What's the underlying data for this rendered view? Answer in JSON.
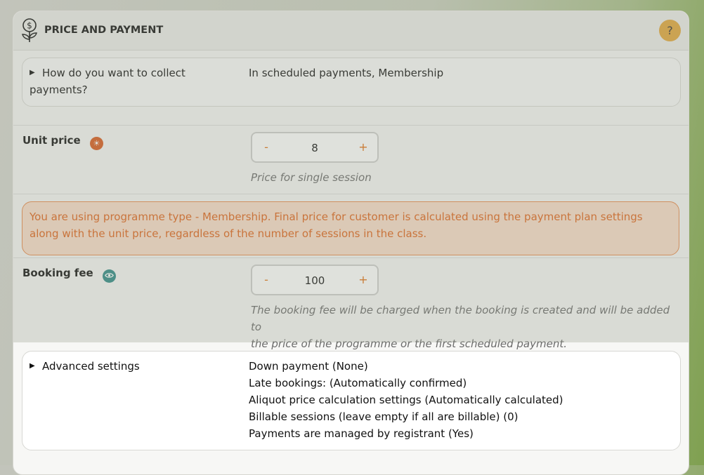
{
  "section": {
    "title": "PRICE AND PAYMENT",
    "icon": "money-plant-icon",
    "help_label": "?"
  },
  "collect": {
    "question_line1": "How do you want to collect",
    "question_line2": "payments?",
    "answer": "In scheduled payments, Membership"
  },
  "unit_price": {
    "label": "Unit price",
    "badge_icon": "sun-icon",
    "badge_color": "#d9591c",
    "minus": "-",
    "plus": "+",
    "value": "8",
    "hint": "Price for single session"
  },
  "alert": {
    "text": "You are using programme type - Membership. Final price for customer is calculated using the payment plan settings along with the unit price, regardless of the number of sessions in the class."
  },
  "booking_fee": {
    "label": "Booking fee",
    "badge_icon": "eye-icon",
    "badge_color": "#2f8a86",
    "minus": "-",
    "plus": "+",
    "value": "100",
    "hint_line1": "The booking fee will be charged when the booking is created and will be added to",
    "hint_line2": "the price of the programme or the first scheduled payment."
  },
  "advanced": {
    "label": "Advanced settings",
    "items": [
      "Down payment (None)",
      "Late bookings: (Automatically confirmed)",
      "Aliquot price calculation settings (Automatically calculated)",
      "Billable sessions (leave empty if all are billable) (0)",
      "Payments are managed by registrant (Yes)"
    ]
  },
  "colors": {
    "accent": "#e07014",
    "help": "#e3a63a"
  }
}
